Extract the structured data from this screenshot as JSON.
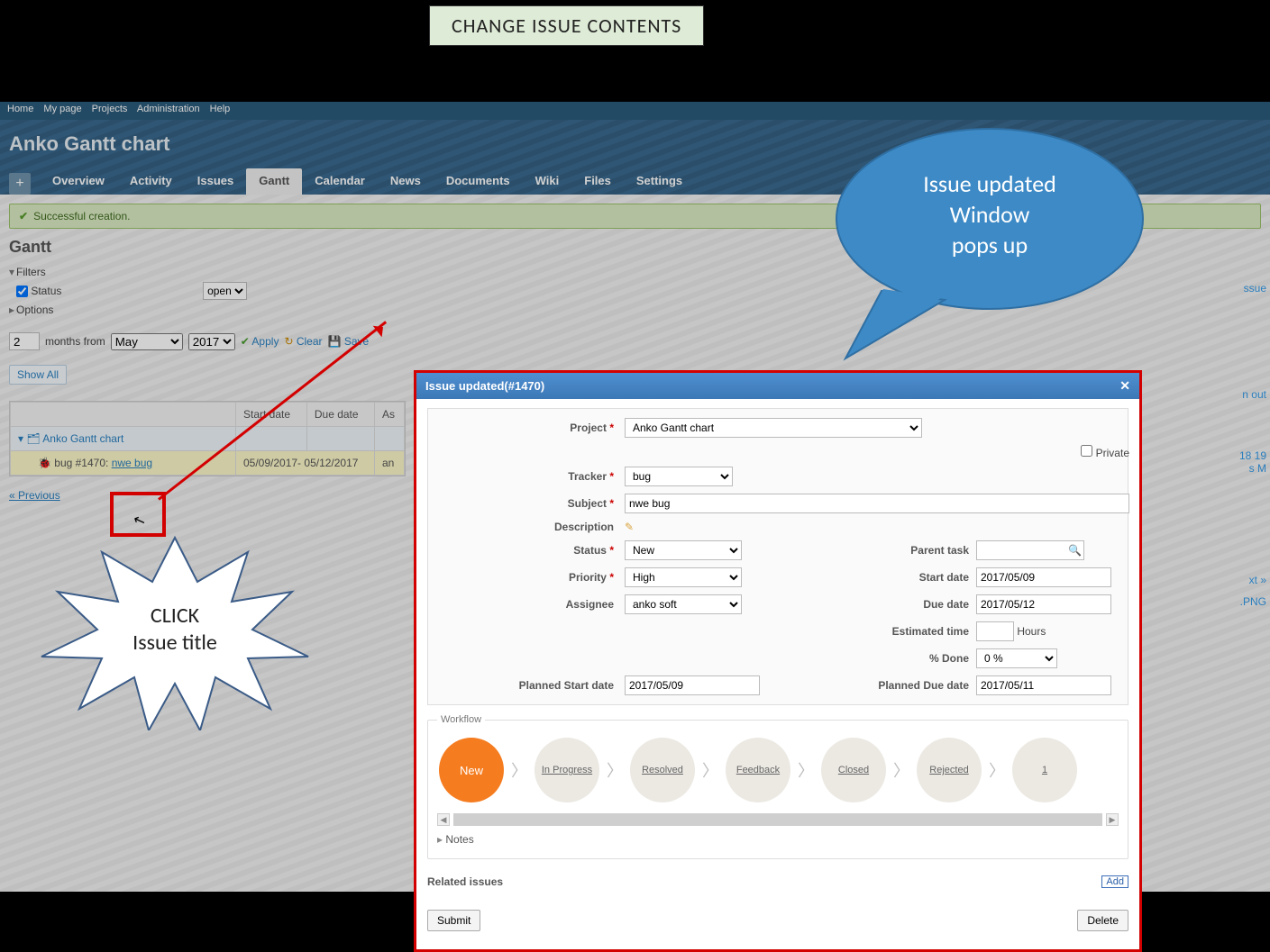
{
  "annotations": {
    "banner": "CHANGE ISSUE CONTENTS",
    "starburst_line1": "CLICK",
    "starburst_line2": "Issue title",
    "speech_line1": "Issue updated",
    "speech_line2": "Window",
    "speech_line3": "pops up"
  },
  "topmenu": {
    "home": "Home",
    "mypage": "My page",
    "projects": "Projects",
    "admin": "Administration",
    "help": "Help"
  },
  "header": {
    "title": "Anko Gantt chart"
  },
  "tabs": {
    "plus": "+",
    "overview": "Overview",
    "activity": "Activity",
    "issues": "Issues",
    "gantt": "Gantt",
    "calendar": "Calendar",
    "news": "News",
    "documents": "Documents",
    "wiki": "Wiki",
    "files": "Files",
    "settings": "Settings"
  },
  "flash": "Successful creation.",
  "page_title": "Gantt",
  "filters": {
    "filters_label": "Filters",
    "status_label": "Status",
    "status_value": "open",
    "options_label": "Options"
  },
  "period": {
    "months_value": "2",
    "months_label": "months from",
    "month": "May",
    "year": "2017",
    "apply": "Apply",
    "clear": "Clear",
    "save": "Save"
  },
  "table": {
    "showall": "Show All",
    "col_start": "Start date",
    "col_due": "Due date",
    "col_as": "As",
    "project_name": "Anko Gantt chart",
    "issue_label": "bug #1470:",
    "issue_title": "nwe bug",
    "dates": "05/09/2017- 05/12/2017",
    "assignee": "an"
  },
  "prev": "« Previous",
  "side_fragments": {
    "issue": "ssue",
    "out": "n out",
    "png": ".PNG",
    "next": "xt »",
    "dates": "18 19",
    "days": "s M"
  },
  "dialog": {
    "title": "Issue updated(#1470)",
    "labels": {
      "project": "Project",
      "tracker": "Tracker",
      "subject": "Subject",
      "description": "Description",
      "status": "Status",
      "priority": "Priority",
      "assignee": "Assignee",
      "private": "Private",
      "parent": "Parent task",
      "start": "Start date",
      "due": "Due date",
      "est": "Estimated time",
      "hours": "Hours",
      "pct": "% Done",
      "pstart": "Planned Start date",
      "pdue": "Planned Due date"
    },
    "values": {
      "project": "Anko Gantt chart",
      "tracker": "bug",
      "subject": "nwe bug",
      "status": "New",
      "priority": "High",
      "assignee": "anko soft",
      "start": "2017/05/09",
      "due": "2017/05/12",
      "est": "",
      "pct": "0 %",
      "pstart": "2017/05/09",
      "pdue": "2017/05/11",
      "parent": ""
    },
    "workflow_label": "Workflow",
    "workflow": [
      "New",
      "In Progress",
      "Resolved",
      "Feedback",
      "Closed",
      "Rejected",
      "1"
    ],
    "notes": "Notes",
    "related": "Related issues",
    "add": "Add",
    "submit": "Submit",
    "delete": "Delete"
  }
}
